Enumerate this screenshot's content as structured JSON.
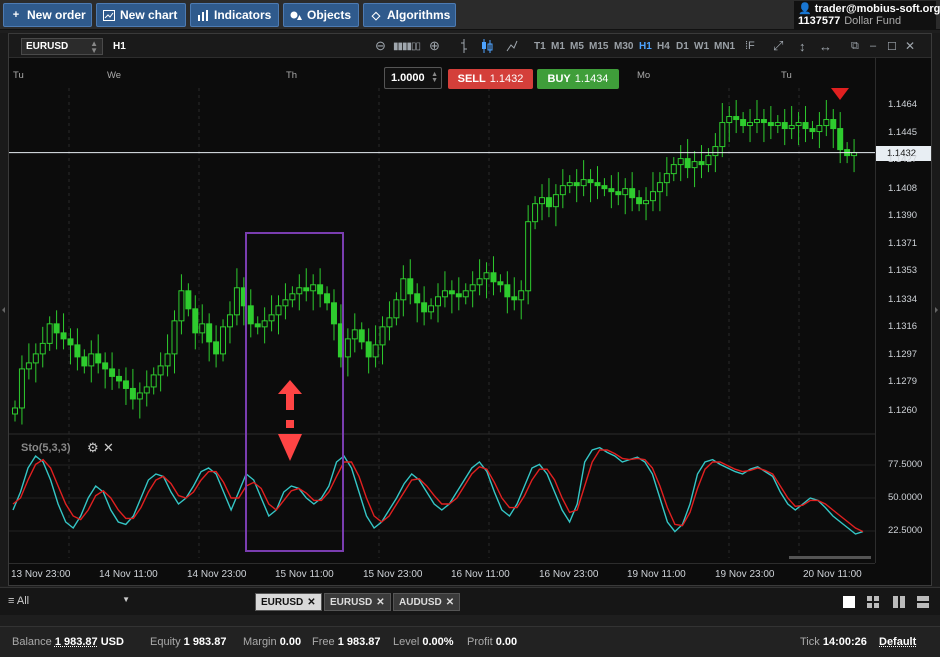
{
  "toolbar": {
    "new_order": "New order",
    "new_chart": "New chart",
    "indicators": "Indicators",
    "objects": "Objects",
    "algorithms": "Algorithms"
  },
  "account": {
    "email": "trader@mobius-soft.org",
    "id": "1137577",
    "fund": "Dollar Fund"
  },
  "chart_window": {
    "symbol": "EURUSD",
    "timeframe": "H1",
    "timeframes": [
      "T1",
      "M1",
      "M5",
      "M15",
      "M30",
      "H1",
      "H4",
      "D1",
      "W1",
      "MN1"
    ],
    "active_timeframe": "H1",
    "quantity": "1.0000",
    "sell_label": "SELL",
    "sell_price": "1.1432",
    "buy_label": "BUY",
    "buy_price": "1.1434",
    "current_price": "1.1432",
    "day_markers": [
      "Tu",
      "We",
      "Th",
      "Mo",
      "Tu"
    ],
    "oscillator_label": "Sto(5,3,3)"
  },
  "chart_data": {
    "type": "candlestick",
    "price_axis_ticks": [
      "1.1464",
      "1.1445",
      "1.1427",
      "1.1408",
      "1.1390",
      "1.1371",
      "1.1353",
      "1.1334",
      "1.1316",
      "1.1297",
      "1.1279",
      "1.1260"
    ],
    "oscillator_axis_ticks": [
      "77.5000",
      "50.0000",
      "22.5000"
    ],
    "time_axis_labels": [
      "13 Nov 23:00",
      "14 Nov 11:00",
      "14 Nov 23:00",
      "15 Nov 11:00",
      "15 Nov 23:00",
      "16 Nov 11:00",
      "16 Nov 23:00",
      "19 Nov 11:00",
      "19 Nov 23:00",
      "20 Nov 11:00"
    ],
    "current_price": 1.1432,
    "candles_close": [
      1.1262,
      1.1288,
      1.1292,
      1.1298,
      1.1305,
      1.1318,
      1.1312,
      1.1308,
      1.1304,
      1.1296,
      1.129,
      1.1298,
      1.1292,
      1.1288,
      1.1283,
      1.128,
      1.1275,
      1.1268,
      1.1272,
      1.1276,
      1.1284,
      1.129,
      1.1298,
      1.132,
      1.134,
      1.1328,
      1.1312,
      1.1318,
      1.1306,
      1.1298,
      1.1316,
      1.1324,
      1.1342,
      1.133,
      1.1318,
      1.1316,
      1.132,
      1.1324,
      1.133,
      1.1334,
      1.1338,
      1.1342,
      1.134,
      1.1344,
      1.1338,
      1.1332,
      1.1318,
      1.1296,
      1.1308,
      1.1314,
      1.1306,
      1.1296,
      1.1304,
      1.1316,
      1.1322,
      1.1334,
      1.1348,
      1.1338,
      1.1332,
      1.1326,
      1.133,
      1.1336,
      1.134,
      1.1338,
      1.1336,
      1.134,
      1.1344,
      1.1348,
      1.1352,
      1.1346,
      1.1344,
      1.1336,
      1.1334,
      1.134,
      1.1386,
      1.1398,
      1.1402,
      1.1396,
      1.1404,
      1.141,
      1.1412,
      1.141,
      1.1414,
      1.1412,
      1.141,
      1.1408,
      1.1406,
      1.1404,
      1.1408,
      1.1402,
      1.1398,
      1.14,
      1.1406,
      1.1412,
      1.1418,
      1.1424,
      1.1428,
      1.1422,
      1.1426,
      1.1424,
      1.143,
      1.1436,
      1.1452,
      1.1456,
      1.1454,
      1.145,
      1.1452,
      1.1454,
      1.1452,
      1.145,
      1.1452,
      1.1448,
      1.145,
      1.1452,
      1.1448,
      1.1446,
      1.145,
      1.1454,
      1.1448,
      1.1434,
      1.143,
      1.1432
    ],
    "sto_k": [
      40,
      55,
      75,
      85,
      80,
      65,
      45,
      30,
      25,
      35,
      50,
      60,
      55,
      40,
      30,
      28,
      35,
      50,
      65,
      70,
      68,
      55,
      45,
      50,
      60,
      72,
      75,
      70,
      55,
      40,
      55,
      70,
      65,
      50,
      35,
      40,
      55,
      60,
      58,
      50,
      45,
      50,
      60,
      80,
      85,
      75,
      55,
      35,
      25,
      30,
      40,
      50,
      62,
      70,
      65,
      55,
      45,
      40,
      45,
      55,
      65,
      75,
      80,
      72,
      55,
      40,
      35,
      45,
      60,
      75,
      78,
      70,
      55,
      40,
      30,
      45,
      80,
      90,
      92,
      88,
      85,
      80,
      82,
      84,
      80,
      70,
      50,
      30,
      22,
      28,
      45,
      70,
      80,
      82,
      78,
      75,
      72,
      70,
      74,
      76,
      72,
      68,
      55,
      45,
      40,
      45,
      50,
      48,
      42,
      35,
      30,
      25,
      20,
      22
    ],
    "sto_d": [
      45,
      50,
      65,
      78,
      82,
      75,
      60,
      45,
      35,
      32,
      40,
      52,
      56,
      50,
      40,
      33,
      33,
      42,
      55,
      65,
      68,
      62,
      52,
      50,
      55,
      65,
      72,
      72,
      63,
      50,
      50,
      60,
      63,
      58,
      45,
      40,
      48,
      56,
      58,
      54,
      48,
      48,
      55,
      68,
      80,
      80,
      68,
      50,
      35,
      30,
      35,
      45,
      55,
      65,
      66,
      60,
      52,
      45,
      45,
      50,
      60,
      70,
      76,
      74,
      63,
      50,
      42,
      42,
      52,
      65,
      74,
      74,
      65,
      50,
      38,
      40,
      60,
      80,
      90,
      90,
      87,
      83,
      82,
      83,
      82,
      75,
      60,
      42,
      28,
      27,
      38,
      58,
      74,
      80,
      80,
      77,
      74,
      72,
      73,
      75,
      73,
      70,
      60,
      50,
      43,
      44,
      48,
      48,
      45,
      40,
      35,
      30,
      25,
      22
    ]
  },
  "tabs": {
    "filter": "All",
    "items": [
      "EURUSD",
      "EURUSD",
      "AUDUSD"
    ]
  },
  "status": {
    "balance_label": "Balance",
    "balance_value": "1 983.87",
    "currency": "USD",
    "equity_label": "Equity",
    "equity_value": "1 983.87",
    "margin_label": "Margin",
    "margin_value": "0.00",
    "free_label": "Free",
    "free_value": "1 983.87",
    "level_label": "Level",
    "level_value": "0.00%",
    "profit_label": "Profit",
    "profit_value": "0.00",
    "tick_label": "Tick",
    "tick_value": "14:00:26",
    "mode": "Default"
  },
  "colors": {
    "bull": "#2ecc2e",
    "bear": "#2ecc2e",
    "sto_k": "#35c6c6",
    "sto_d": "#e02020",
    "highlight_box": "#7a3db0",
    "arrow": "#ff4444"
  }
}
